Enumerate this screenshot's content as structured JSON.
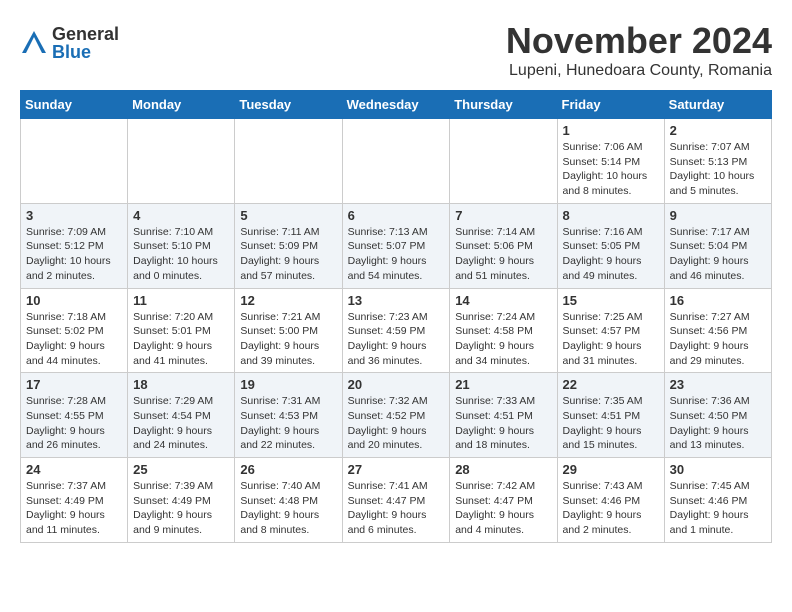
{
  "header": {
    "logo_general": "General",
    "logo_blue": "Blue",
    "month_title": "November 2024",
    "location": "Lupeni, Hunedoara County, Romania"
  },
  "calendar": {
    "days_of_week": [
      "Sunday",
      "Monday",
      "Tuesday",
      "Wednesday",
      "Thursday",
      "Friday",
      "Saturday"
    ],
    "weeks": [
      [
        {
          "day": "",
          "info": ""
        },
        {
          "day": "",
          "info": ""
        },
        {
          "day": "",
          "info": ""
        },
        {
          "day": "",
          "info": ""
        },
        {
          "day": "",
          "info": ""
        },
        {
          "day": "1",
          "info": "Sunrise: 7:06 AM\nSunset: 5:14 PM\nDaylight: 10 hours and 8 minutes."
        },
        {
          "day": "2",
          "info": "Sunrise: 7:07 AM\nSunset: 5:13 PM\nDaylight: 10 hours and 5 minutes."
        }
      ],
      [
        {
          "day": "3",
          "info": "Sunrise: 7:09 AM\nSunset: 5:12 PM\nDaylight: 10 hours and 2 minutes."
        },
        {
          "day": "4",
          "info": "Sunrise: 7:10 AM\nSunset: 5:10 PM\nDaylight: 10 hours and 0 minutes."
        },
        {
          "day": "5",
          "info": "Sunrise: 7:11 AM\nSunset: 5:09 PM\nDaylight: 9 hours and 57 minutes."
        },
        {
          "day": "6",
          "info": "Sunrise: 7:13 AM\nSunset: 5:07 PM\nDaylight: 9 hours and 54 minutes."
        },
        {
          "day": "7",
          "info": "Sunrise: 7:14 AM\nSunset: 5:06 PM\nDaylight: 9 hours and 51 minutes."
        },
        {
          "day": "8",
          "info": "Sunrise: 7:16 AM\nSunset: 5:05 PM\nDaylight: 9 hours and 49 minutes."
        },
        {
          "day": "9",
          "info": "Sunrise: 7:17 AM\nSunset: 5:04 PM\nDaylight: 9 hours and 46 minutes."
        }
      ],
      [
        {
          "day": "10",
          "info": "Sunrise: 7:18 AM\nSunset: 5:02 PM\nDaylight: 9 hours and 44 minutes."
        },
        {
          "day": "11",
          "info": "Sunrise: 7:20 AM\nSunset: 5:01 PM\nDaylight: 9 hours and 41 minutes."
        },
        {
          "day": "12",
          "info": "Sunrise: 7:21 AM\nSunset: 5:00 PM\nDaylight: 9 hours and 39 minutes."
        },
        {
          "day": "13",
          "info": "Sunrise: 7:23 AM\nSunset: 4:59 PM\nDaylight: 9 hours and 36 minutes."
        },
        {
          "day": "14",
          "info": "Sunrise: 7:24 AM\nSunset: 4:58 PM\nDaylight: 9 hours and 34 minutes."
        },
        {
          "day": "15",
          "info": "Sunrise: 7:25 AM\nSunset: 4:57 PM\nDaylight: 9 hours and 31 minutes."
        },
        {
          "day": "16",
          "info": "Sunrise: 7:27 AM\nSunset: 4:56 PM\nDaylight: 9 hours and 29 minutes."
        }
      ],
      [
        {
          "day": "17",
          "info": "Sunrise: 7:28 AM\nSunset: 4:55 PM\nDaylight: 9 hours and 26 minutes."
        },
        {
          "day": "18",
          "info": "Sunrise: 7:29 AM\nSunset: 4:54 PM\nDaylight: 9 hours and 24 minutes."
        },
        {
          "day": "19",
          "info": "Sunrise: 7:31 AM\nSunset: 4:53 PM\nDaylight: 9 hours and 22 minutes."
        },
        {
          "day": "20",
          "info": "Sunrise: 7:32 AM\nSunset: 4:52 PM\nDaylight: 9 hours and 20 minutes."
        },
        {
          "day": "21",
          "info": "Sunrise: 7:33 AM\nSunset: 4:51 PM\nDaylight: 9 hours and 18 minutes."
        },
        {
          "day": "22",
          "info": "Sunrise: 7:35 AM\nSunset: 4:51 PM\nDaylight: 9 hours and 15 minutes."
        },
        {
          "day": "23",
          "info": "Sunrise: 7:36 AM\nSunset: 4:50 PM\nDaylight: 9 hours and 13 minutes."
        }
      ],
      [
        {
          "day": "24",
          "info": "Sunrise: 7:37 AM\nSunset: 4:49 PM\nDaylight: 9 hours and 11 minutes."
        },
        {
          "day": "25",
          "info": "Sunrise: 7:39 AM\nSunset: 4:49 PM\nDaylight: 9 hours and 9 minutes."
        },
        {
          "day": "26",
          "info": "Sunrise: 7:40 AM\nSunset: 4:48 PM\nDaylight: 9 hours and 8 minutes."
        },
        {
          "day": "27",
          "info": "Sunrise: 7:41 AM\nSunset: 4:47 PM\nDaylight: 9 hours and 6 minutes."
        },
        {
          "day": "28",
          "info": "Sunrise: 7:42 AM\nSunset: 4:47 PM\nDaylight: 9 hours and 4 minutes."
        },
        {
          "day": "29",
          "info": "Sunrise: 7:43 AM\nSunset: 4:46 PM\nDaylight: 9 hours and 2 minutes."
        },
        {
          "day": "30",
          "info": "Sunrise: 7:45 AM\nSunset: 4:46 PM\nDaylight: 9 hours and 1 minute."
        }
      ]
    ]
  }
}
